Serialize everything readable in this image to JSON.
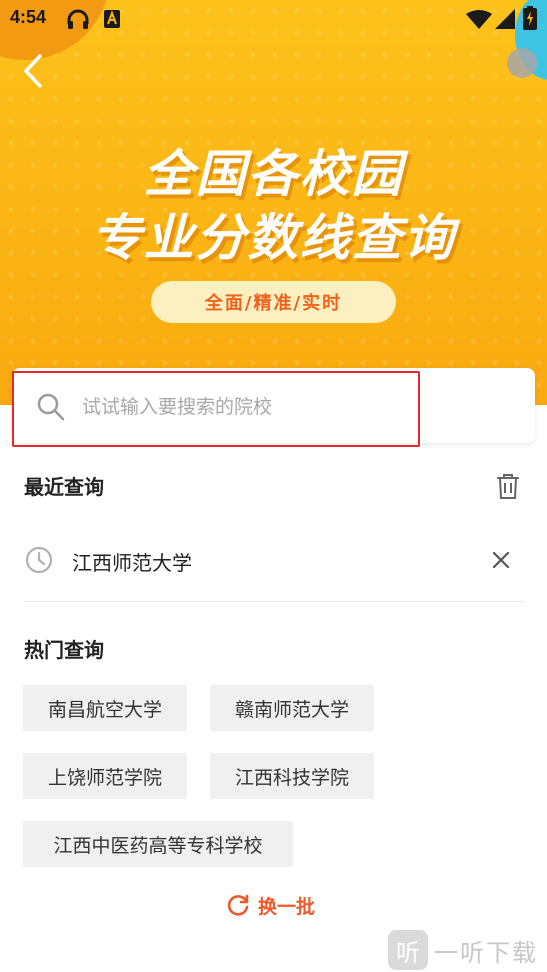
{
  "status_bar": {
    "time": "4:54",
    "icons": [
      "headphones-icon",
      "a-notification-icon",
      "wifi-icon",
      "cellular-icon",
      "battery-charging-icon"
    ]
  },
  "header": {
    "title_line1": "全国各校园",
    "title_line2": "专业分数线查询",
    "subtitle": "全面/精准/实时",
    "banner_color": "#fbb515"
  },
  "search": {
    "placeholder": "试试输入要搜索的院校",
    "value": "",
    "highlight_color": "#e3282e"
  },
  "recent": {
    "title": "最近查询",
    "items": [
      "江西师范大学"
    ]
  },
  "hot": {
    "title": "热门查询",
    "items": [
      "南昌航空大学",
      "赣南师范大学",
      "上饶师范学院",
      "江西科技学院",
      "江西中医药高等专科学校"
    ]
  },
  "refresh": {
    "label": "换一批",
    "color": "#ec5a2c"
  },
  "watermark": {
    "logo_char": "听",
    "text": "一听下载"
  }
}
